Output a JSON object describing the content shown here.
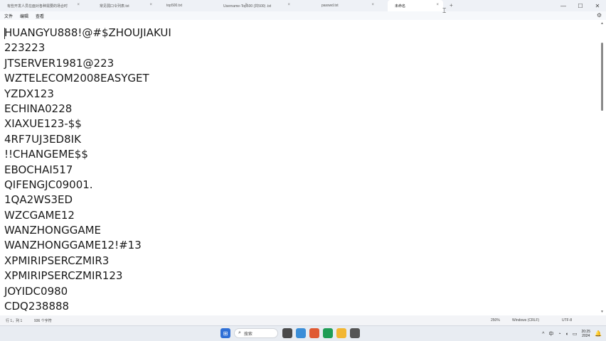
{
  "tabs": [
    {
      "label": "有些开发人员在面对各种需要的场合时",
      "close": "×"
    },
    {
      "label": "top500.txt",
      "close": "×"
    },
    {
      "label": "常见弱口令列表.txt",
      "close": "×"
    },
    {
      "label": "Username-Top500 (共500) .txt",
      "close": "×"
    },
    {
      "label": "passwd.txt",
      "close": "×"
    },
    {
      "label": "未命名",
      "close": "×",
      "active": true
    }
  ],
  "new_tab": "+",
  "window_controls": {
    "minimize": "—",
    "maximize": "☐",
    "close": "✕"
  },
  "menu": {
    "file": "文件",
    "edit": "编辑",
    "view": "查看",
    "settings_icon": "⚙"
  },
  "editor": {
    "lines": [
      "HUANGYU888!@#$ZHOUJIAKUI",
      "223223",
      "JTSERVER1981@223",
      "WZTELECOM2008EASYGET",
      "YZDX123",
      "ECHINA0228",
      "XIAXUE123-$$",
      "4RF7UJ3ED8IK",
      "!!CHANGEME$$",
      "EBOCHAI517",
      "QIFENGJC09001.",
      "1QA2WS3ED",
      "WZCGAME12",
      "WANZHONGGAME",
      "WANZHONGGAME12!#13",
      "XPMIRIPSERCZMIR3",
      "XPMIRIPSERCZMIR123",
      "JOYIDC0980",
      "CDQ238888"
    ]
  },
  "status": {
    "position": "行 1，列 1",
    "chars": "936 个字符",
    "zoom": "250%",
    "eol": "Windows (CRLF)",
    "encoding": "UTF-8"
  },
  "taskbar": {
    "start_icon": "⊞",
    "search_label": "搜索",
    "search_icon": "⌕",
    "clock_time": "20:25",
    "clock_date": "2024"
  },
  "tray": {
    "chevron": "^",
    "wifi": "◔",
    "volume": "◖",
    "battery": "▭",
    "ime": "中"
  },
  "colors": {
    "tab_bar": "#eef1f6",
    "menu_bar": "#f6f8fb",
    "editor_bg": "#ffffff",
    "status_bar": "#f3f4f7",
    "taskbar": "#e8ecf2"
  }
}
